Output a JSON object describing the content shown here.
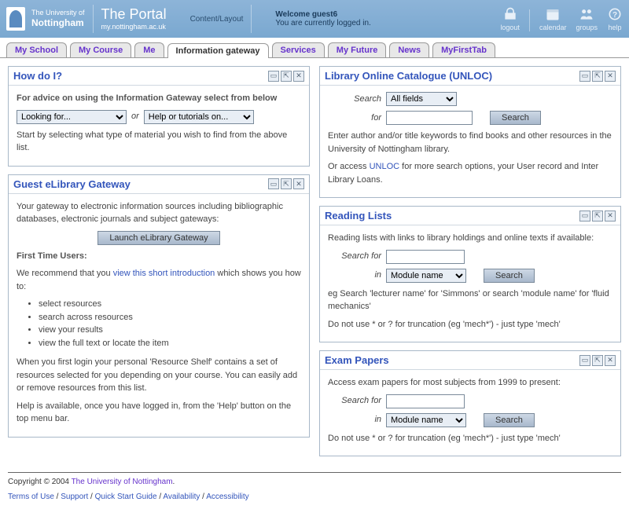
{
  "header": {
    "university_prefix": "The University of",
    "university_name": "Nottingham",
    "portal_title": "The Portal",
    "portal_url": "my.nottingham.ac.uk",
    "content_layout": "Content/Layout",
    "welcome_label": "Welcome guest6",
    "logged_in_text": "You are currently logged in.",
    "icons": {
      "logout": "logout",
      "calendar": "calendar",
      "groups": "groups",
      "help": "help"
    }
  },
  "tabs": [
    "My School",
    "My Course",
    "Me",
    "Information gateway",
    "Services",
    "My Future",
    "News",
    "MyFirstTab"
  ],
  "active_tab_index": 3,
  "howdoi": {
    "title": "How do I?",
    "intro": "For advice on using the Information Gateway select from below",
    "select1": "Looking for...",
    "or_text": "or",
    "select2": "Help or tutorials on...",
    "hint": "Start by selecting what type of material you wish to find from the above list."
  },
  "elib": {
    "title": "Guest eLibrary Gateway",
    "intro": "Your gateway to electronic information sources including bibliographic databases, electronic journals and subject gateways:",
    "launch_button": "Launch eLibrary Gateway",
    "first_time_heading": "First Time Users:",
    "recommend_pre": "We recommend that you ",
    "recommend_link": "view this short introduction",
    "recommend_post": " which shows you how to:",
    "bullets": [
      "select resources",
      "search across resources",
      "view your results",
      "view the full text or locate the item"
    ],
    "para2": "When you first login your personal 'Resource Shelf' contains a set of resources selected for you depending on your course. You can easily add or remove resources from this list.",
    "para3": "Help is available, once you have logged in, from the 'Help' button on the top menu bar."
  },
  "unloc": {
    "title": "Library Online Catalogue (UNLOC)",
    "search_label": "Search",
    "search_select": "All fields",
    "for_label": "for",
    "search_button": "Search",
    "hint1": "Enter author and/or title keywords to find books and other resources in the University of Nottingham library.",
    "hint2_pre": "Or access ",
    "hint2_link": "UNLOC",
    "hint2_post": " for more search options, your User record and Inter Library Loans."
  },
  "reading": {
    "title": "Reading Lists",
    "intro": "Reading lists with links to library holdings and online texts if available:",
    "search_for_label": "Search for",
    "in_label": "in",
    "in_select": "Module name",
    "search_button": "Search",
    "eg": "eg Search 'lecturer name' for 'Simmons' or search 'module name' for 'fluid mechanics'",
    "note": "Do not use * or ? for truncation (eg 'mech*') - just type 'mech'"
  },
  "exam": {
    "title": "Exam Papers",
    "intro": "Access exam papers for most subjects from 1999 to present:",
    "search_for_label": "Search for",
    "in_label": "in",
    "in_select": "Module name",
    "search_button": "Search",
    "note": "Do not use * or ? for truncation (eg 'mech*') - just type 'mech'"
  },
  "footer": {
    "copyright_pre": "Copyright © 2004 ",
    "copyright_link": "The University of Nottingham",
    "links": [
      "Terms of Use",
      "Support",
      "Quick Start Guide",
      "Availability",
      "Accessibility"
    ]
  }
}
